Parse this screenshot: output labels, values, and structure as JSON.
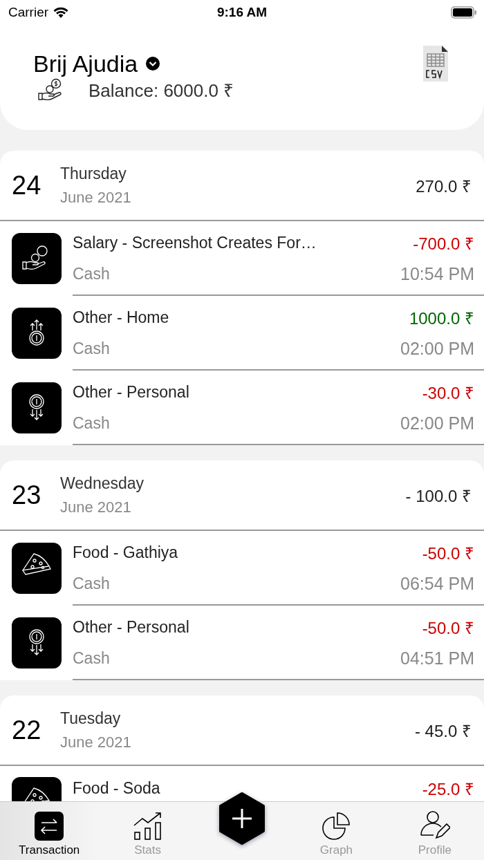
{
  "status_bar": {
    "carrier": "Carrier",
    "time": "9:16 AM"
  },
  "header": {
    "name": "Brij Ajudia",
    "balance": "Balance: 6000.0 ₹"
  },
  "days": [
    {
      "day": "24",
      "weekday": "Thursday",
      "month": "June 2021",
      "total": "270.0 ₹",
      "transactions": [
        {
          "kind": "salary",
          "title": "Salary - Screenshot Creates For…",
          "color": "#cc0000",
          "amount": "-700.0 ₹",
          "account": "Cash",
          "time": "10:54 PM"
        },
        {
          "kind": "income",
          "title": "Other - Home",
          "color": "#006600",
          "amount": "1000.0 ₹",
          "account": "Cash",
          "time": "02:00 PM"
        },
        {
          "kind": "outgo",
          "title": "Other - Personal",
          "color": "#cc0000",
          "amount": "-30.0 ₹",
          "account": "Cash",
          "time": "02:00 PM"
        }
      ]
    },
    {
      "day": "23",
      "weekday": "Wednesday",
      "month": "June 2021",
      "total": "- 100.0 ₹",
      "transactions": [
        {
          "kind": "food",
          "title": "Food - Gathiya",
          "color": "#cc0000",
          "amount": "-50.0 ₹",
          "account": "Cash",
          "time": "06:54 PM"
        },
        {
          "kind": "outgo",
          "title": "Other - Personal",
          "color": "#cc0000",
          "amount": "-50.0 ₹",
          "account": "Cash",
          "time": "04:51 PM"
        }
      ]
    },
    {
      "day": "22",
      "weekday": "Tuesday",
      "month": "June 2021",
      "total": "- 45.0 ₹",
      "transactions": [
        {
          "kind": "food",
          "title": "Food - Soda",
          "color": "#cc0000",
          "amount": "-25.0 ₹"
        }
      ]
    }
  ],
  "tabs": [
    {
      "kind": "transaction",
      "label": "Transaction",
      "selected": true
    },
    {
      "kind": "stats",
      "label": "Stats",
      "selected": false
    },
    {
      "kind": "add"
    },
    {
      "kind": "graph",
      "label": "Graph",
      "selected": false
    },
    {
      "kind": "profile",
      "label": "Profile",
      "selected": false
    }
  ]
}
